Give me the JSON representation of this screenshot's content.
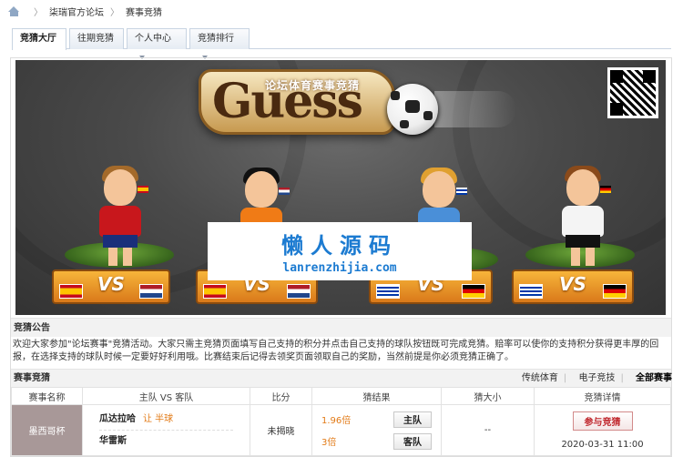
{
  "breadcrumb": {
    "items": [
      "柒瑞官方论坛",
      "赛事竞猜"
    ]
  },
  "tabs": [
    {
      "label": "竞猜大厅",
      "active": true,
      "has_dropdown": false
    },
    {
      "label": "往期竞猜",
      "active": false,
      "has_dropdown": false
    },
    {
      "label": "个人中心",
      "active": false,
      "has_dropdown": true
    },
    {
      "label": "竞猜排行",
      "active": false,
      "has_dropdown": true
    }
  ],
  "banner": {
    "logo_text": "Guess",
    "logo_subtitle": "论坛体育赛事竞猜",
    "vs_label": "VS",
    "watermark_cn": "懒人源码",
    "watermark_en": "lanrenzhijia.com"
  },
  "notice": {
    "title": "竞猜公告",
    "text": "欢迎大家参加\"论坛赛事\"竞猜活动。大家只需主竞猜页面填写自己支持的积分并点击自己支持的球队按钮既可完成竞猜。赔率可以使你的支持积分获得更丰厚的回报，在选择支持的球队时候一定要好好利用哦。比赛结束后记得去领奖页面领取自己的奖励，当然前提是你必须竞猜正确了。"
  },
  "matches_section": {
    "title": "赛事竞猜",
    "filters": [
      "传统体育",
      "电子竞技",
      "全部赛事"
    ],
    "active_filter": "全部赛事",
    "columns": [
      "赛事名称",
      "主队 VS 客队",
      "比分",
      "猜结果",
      "猜大小",
      "竞猜详情"
    ],
    "rows": [
      {
        "league": "墨西哥杯",
        "home_team": "瓜达拉哈",
        "handicap": "让 半球",
        "away_team": "华雷斯",
        "score": "未揭晓",
        "home_odds": "1.96倍",
        "home_button": "主队",
        "away_odds": "3倍",
        "away_button": "客队",
        "size": "--",
        "join_button": "参与竞猜",
        "date": "2020-03-31 11:00"
      }
    ]
  },
  "colors": {
    "accent_blue": "#1c7bd1",
    "odds_orange": "#e27a16",
    "join_red": "#c0272d",
    "league_bg": "#a89898"
  }
}
